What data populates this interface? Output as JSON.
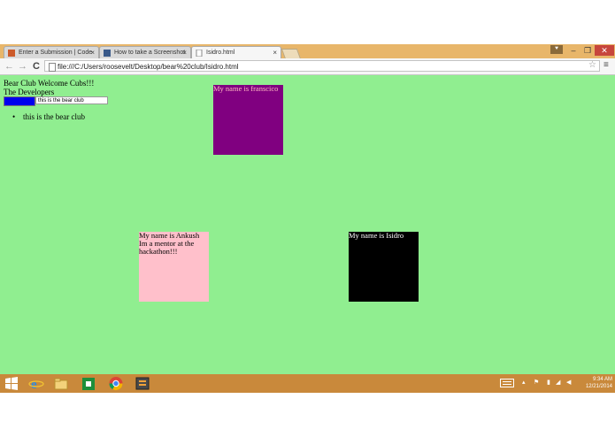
{
  "browser": {
    "tabs": [
      {
        "title": "Enter a Submission | Code"
      },
      {
        "title": "How to take a Screenshot"
      },
      {
        "title": "Isidro.html",
        "active": true
      }
    ],
    "address_bar": {
      "url": "file:///C:/Users/roosevelt/Desktop/bear%20club/Isidro.html"
    },
    "window_controls": {
      "minimize": "–",
      "maximize": "❐",
      "close": "✕"
    },
    "tab_close_glyph": "×",
    "nav": {
      "back": "←",
      "forward": "→",
      "reload": "C"
    },
    "star_glyph": "☆",
    "menu_glyph": "≡",
    "profile_glyph": "⯆"
  },
  "page": {
    "background": "#90ee90",
    "heading": "Bear Club Welcome Cubs!!!",
    "subheading": "The Developers",
    "input": {
      "value": "this is the bear club"
    },
    "list": {
      "items": [
        "this is the bear club"
      ]
    },
    "cards": {
      "francisco": {
        "text": "My name is franscico",
        "background": "#800080",
        "color": "#ffb6c1"
      },
      "ankush": {
        "text": "My name is Ankush Im a mentor at the hackathon!!!",
        "background": "#ffc0cb",
        "color": "#000000"
      },
      "isidro": {
        "text": "My name is Isidro",
        "background": "#000000",
        "color": "#ffffff"
      }
    }
  },
  "taskbar": {
    "icons": [
      "windows-start-icon",
      "internet-explorer-icon",
      "file-explorer-icon",
      "store-icon",
      "chrome-icon",
      "sublime-text-icon"
    ],
    "clock": {
      "time": "9:34 AM",
      "date": "12/21/2014"
    }
  }
}
